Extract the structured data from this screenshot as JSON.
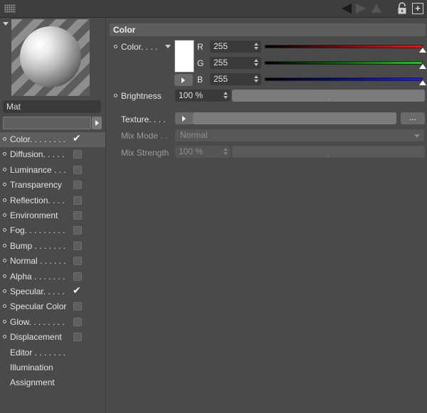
{
  "toolbar": {
    "icons": [
      "grip-icon",
      "back-arrow-icon",
      "forward-arrow-icon",
      "up-arrow-icon",
      "lock-icon",
      "new-window-icon"
    ],
    "new_window_glyph": "+"
  },
  "material": {
    "name": "Mat"
  },
  "channels": [
    {
      "label": "Color. . . . . . . .",
      "has_dot": true,
      "checked": true,
      "active": true
    },
    {
      "label": "Diffusion. . . . .",
      "has_dot": true,
      "checked": false,
      "active": false
    },
    {
      "label": "Luminance . . .",
      "has_dot": true,
      "checked": false,
      "active": false
    },
    {
      "label": "Transparency",
      "has_dot": true,
      "checked": false,
      "active": false
    },
    {
      "label": "Reflection. . . .",
      "has_dot": true,
      "checked": false,
      "active": false
    },
    {
      "label": "Environment",
      "has_dot": true,
      "checked": false,
      "active": false
    },
    {
      "label": "Fog. . . . . . . . .",
      "has_dot": true,
      "checked": false,
      "active": false
    },
    {
      "label": "Bump . . . . . . .",
      "has_dot": true,
      "checked": false,
      "active": false
    },
    {
      "label": "Normal . . . . . .",
      "has_dot": true,
      "checked": false,
      "active": false
    },
    {
      "label": "Alpha . . . . . . .",
      "has_dot": true,
      "checked": false,
      "active": false
    },
    {
      "label": "Specular. . . . .",
      "has_dot": true,
      "checked": true,
      "active": false
    },
    {
      "label": "Specular Color",
      "has_dot": true,
      "checked": false,
      "active": false
    },
    {
      "label": "Glow. . . . . . . .",
      "has_dot": true,
      "checked": false,
      "active": false
    },
    {
      "label": "Displacement",
      "has_dot": true,
      "checked": false,
      "active": false
    },
    {
      "label": "Editor . . . . . . .",
      "has_dot": false,
      "checked": null,
      "active": false
    },
    {
      "label": "Illumination",
      "has_dot": false,
      "checked": null,
      "active": false
    },
    {
      "label": "Assignment",
      "has_dot": false,
      "checked": null,
      "active": false
    }
  ],
  "section": {
    "title": "Color"
  },
  "color": {
    "label": "Color. . . .",
    "swatch": "#ffffff",
    "r_label": "R",
    "g_label": "G",
    "b_label": "B",
    "r": "255",
    "g": "255",
    "b": "255",
    "r_level": 1.0,
    "g_level": 1.0,
    "b_level": 1.0,
    "r_gradient": [
      "#000000",
      "#ff1010"
    ],
    "g_gradient": [
      "#000000",
      "#10d010"
    ],
    "b_gradient": [
      "#000000",
      "#1a1aff"
    ]
  },
  "brightness": {
    "label": "Brightness",
    "value": "100 %"
  },
  "texture": {
    "label": "Texture. . . .",
    "browse_label": "..."
  },
  "mix_mode": {
    "label": "Mix Mode . .",
    "value": "Normal"
  },
  "mix_strength": {
    "label": "Mix Strength",
    "value": "100 %"
  }
}
